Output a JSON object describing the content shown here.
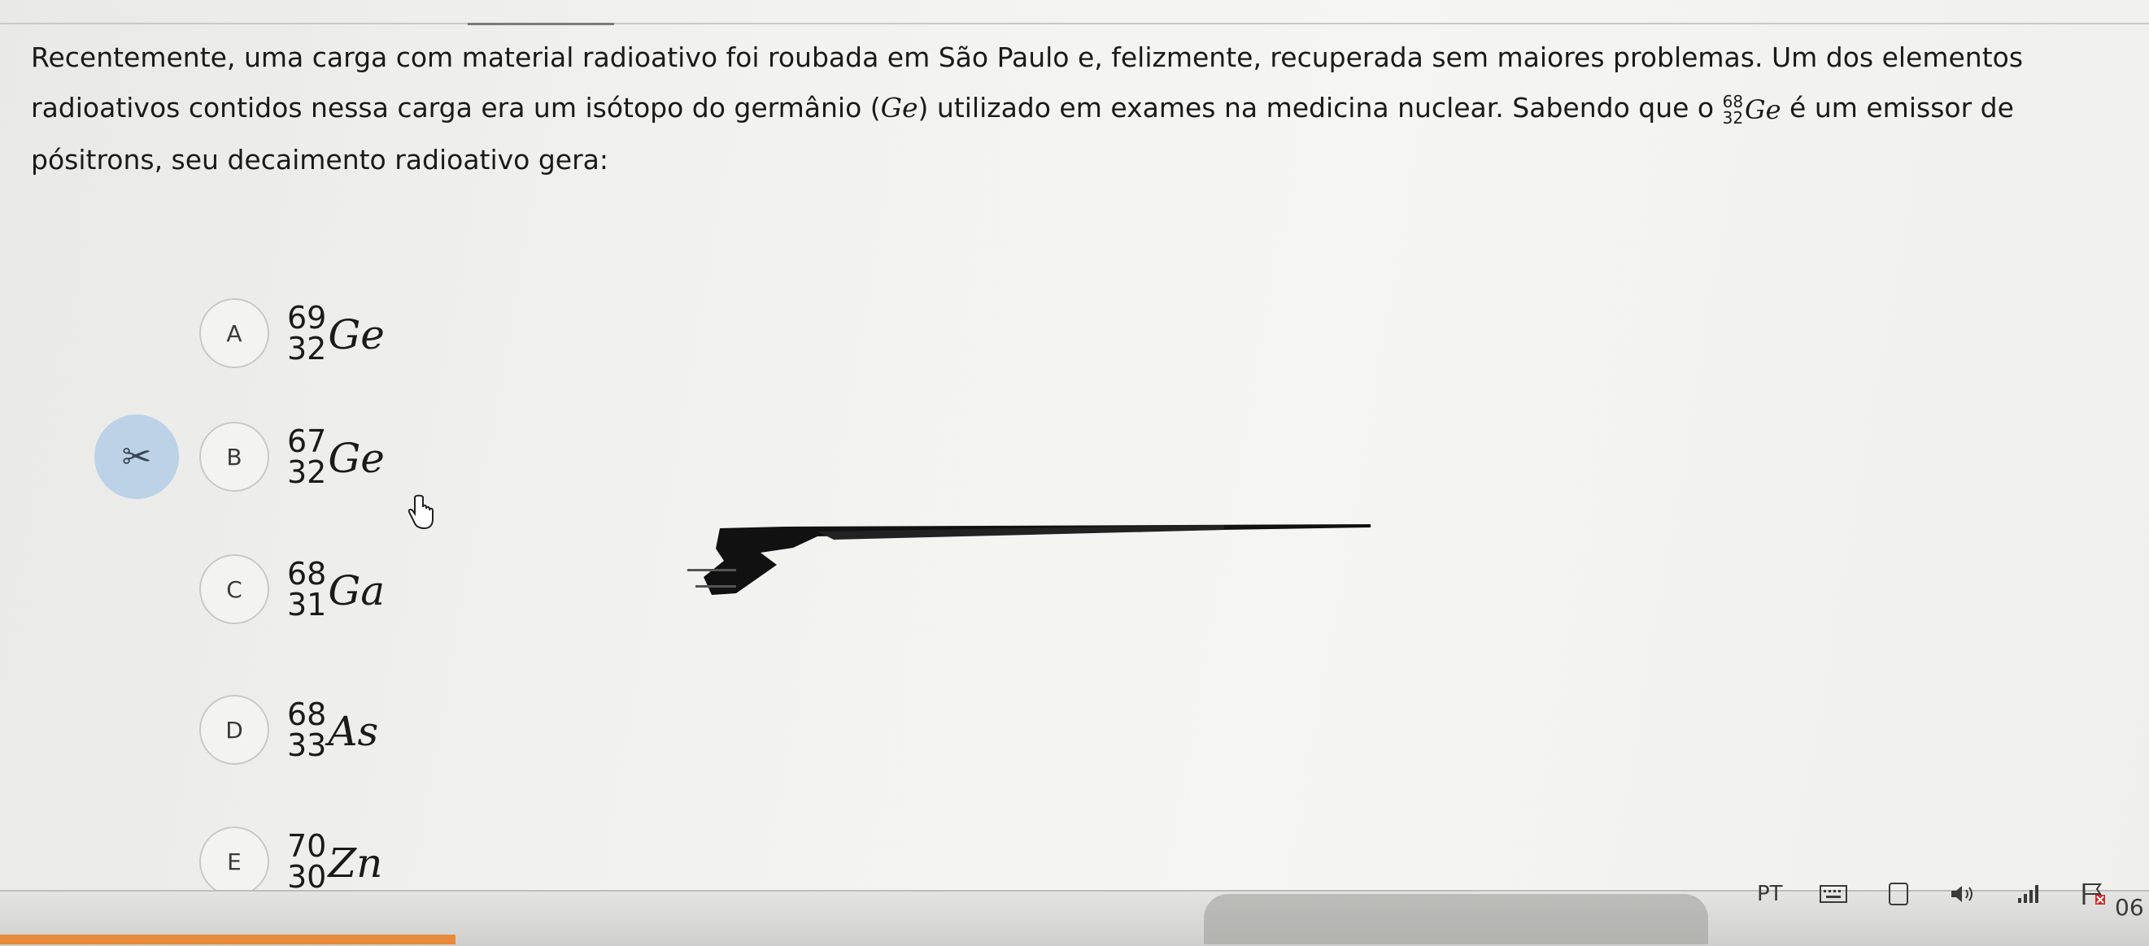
{
  "question": {
    "line1": "Recentemente, uma carga com material radioativo foi roubada em São Paulo e, felizmente, recuperada sem maiores problemas. Um dos elementos",
    "line2_pre": "radioativos contidos nessa carga era um isótopo do germânio (",
    "line2_element": "Ge",
    "line2_mid": ") utilizado em exames na medicina nuclear. Sabendo que o ",
    "inline_isotope": {
      "mass": "68",
      "atomic": "32",
      "symbol": "Ge"
    },
    "line2_post": " é um emissor de",
    "line3": "pósitrons, seu decaimento radioativo gera:"
  },
  "scissors_icon": "scissors-icon",
  "options": [
    {
      "letter": "A",
      "mass": "69",
      "atomic": "32",
      "symbol": "Ge"
    },
    {
      "letter": "B",
      "mass": "67",
      "atomic": "32",
      "symbol": "Ge"
    },
    {
      "letter": "C",
      "mass": "68",
      "atomic": "31",
      "symbol": "Ga"
    },
    {
      "letter": "D",
      "mass": "68",
      "atomic": "33",
      "symbol": "As"
    },
    {
      "letter": "E",
      "mass": "70",
      "atomic": "30",
      "symbol": "Zn"
    }
  ],
  "taskbar": {
    "language": "PT",
    "clock": "06",
    "icons": [
      "keyboard-icon",
      "tablet-icon",
      "volume-icon",
      "signal-icon",
      "flag-icon"
    ]
  }
}
